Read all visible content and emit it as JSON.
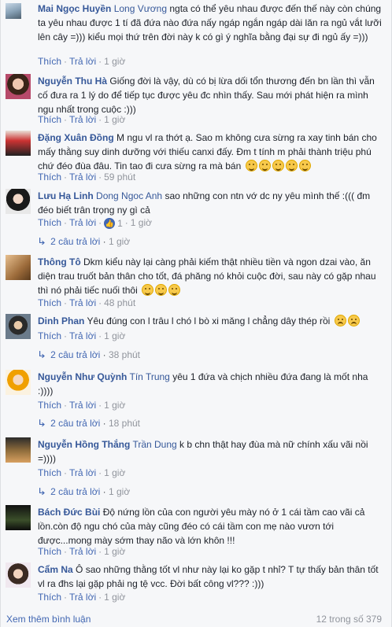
{
  "actions": {
    "like": "Thích",
    "reply": "Trả lời"
  },
  "comments": [
    {
      "name": "Mai Ngọc Huyền",
      "tag": "Long Vương",
      "text": "ngta có thể yêu nhau được đến thế này còn chúng ta yêu nhau được 1 tí đã đứa nào đứa nấy ngáp ngắn ngáp dài lăn ra ngủ vắt lưỡi lên cây =))) kiểu mọi thứ trên đời này k có gì ý nghĩa bằng đại sự đi ngủ ấy =)))",
      "time": "1 giờ"
    },
    {
      "name": "Nguyễn Thu Hà",
      "tag": "",
      "text": "Giống đời là vậy, dù có bị lừa dối tổn thương đến bn lần thì vẫn cố đưa ra 1 lý do để tiếp tục được yêu đc nhìn thấy. Sau mới phát hiện ra mình ngu nhất trong cuộc :)))",
      "time": "1 giờ"
    },
    {
      "name": "Đặng Xuân Đồng",
      "tag": "",
      "text": "M ngu vl ra thớt ạ. Sao m không cưa sừng ra xay tinh bán cho mấy thằng suy dinh dưỡng với thiếu canxi đấy. Đm t tính m phải thành triệu phú chứ đéo đùa đâu. Tin tao đi cưa sừng ra mà bán",
      "emoji_count": 5,
      "time": "59 phút"
    },
    {
      "name": "Lưu Hạ Linh",
      "tag": "Dong Ngoc Anh",
      "text": "sao những con ntn vớ dc ny yêu mình thế :((( đm đéo biết trân trọng ny gì cả",
      "likes": "1",
      "time": "1 giờ",
      "replies": "2 câu trả lời",
      "replies_time": "1 giờ"
    },
    {
      "name": "Thông Tô",
      "tag": "",
      "text": "Dkm kiểu này lại càng phải kiếm thật nhiều tiền và ngon dzai vào, ăn diện trau truốt bản thân cho tốt, đá phăng nó khỏi cuộc đời, sau này có gặp nhau thì nó phải tiếc nuối thôi",
      "emoji_count": 3,
      "time": "48 phút"
    },
    {
      "name": "Dinh Phan",
      "tag": "",
      "text": "Yêu đúng con l trâu l chó l bò xi măng l chẳng dây thép rồi",
      "emoji_count": 2,
      "time": "1 giờ",
      "replies": "2 câu trả lời",
      "replies_time": "38 phút"
    },
    {
      "name": "Nguyễn Như Quỳnh",
      "tag": "Tín Trung",
      "text": "yêu 1 đứa và chịch nhiều đứa đang là mốt nha :))))",
      "time": "1 giờ",
      "replies": "2 câu trả lời",
      "replies_time": "18 phút"
    },
    {
      "name": "Nguyễn Hồng Thắng",
      "tag": "Trần Dung",
      "text": "k b chn thật hay đùa mà nữ chính xấu vãi nồi =))))",
      "time": "1 giờ",
      "replies": "2 câu trả lời",
      "replies_time": "1 giờ"
    },
    {
      "name": "Bách Đức Bùi",
      "tag": "",
      "text": "Độ nứng lồn của con người yêu mày nó ở 1 cái tầm cao vãi cả lồn.còn độ ngu chó của mày cũng đéo có cái tầm con mẹ nào vươn tới được...mong mày sớm thay não và lớn khôn !!!",
      "time": "1 giờ"
    },
    {
      "name": "Cẩm Na",
      "tag": "",
      "text": "Ô sao những thằng tốt vl như này lại ko gặp t nhỉ? T tự thấy bản thân tốt vl ra đhs lại gặp phải ng tệ vcc. Đời bất công vl??? :)))",
      "time": "1 giờ"
    }
  ],
  "footer": {
    "more": "Xem thêm bình luận",
    "count": "12 trong số 379"
  }
}
